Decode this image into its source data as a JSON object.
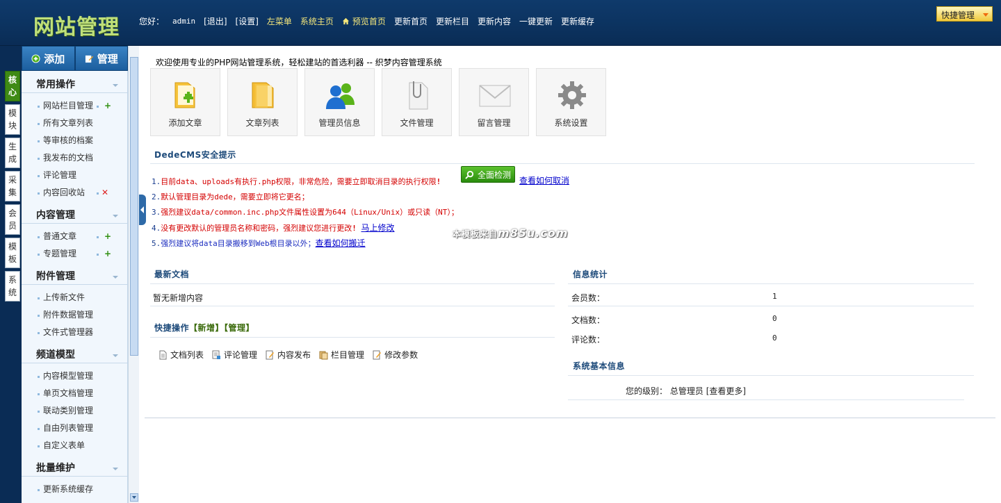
{
  "header": {
    "logo_text": "网站管理",
    "greeting": "您好：",
    "username": "admin",
    "nav": [
      "[退出]",
      "[设置]",
      "左菜单",
      "系统主页",
      "预览首页",
      "更新首页",
      "更新栏目",
      "更新内容",
      "一键更新",
      "更新缓存"
    ],
    "quick_button": "快捷管理"
  },
  "side_tabs": [
    "核心",
    "模块",
    "生成",
    "采集",
    "会员",
    "模板",
    "系统"
  ],
  "menu_head": {
    "add": "添加",
    "manage": "管理"
  },
  "menu": [
    {
      "title": "常用操作",
      "items": [
        {
          "label": "网站栏目管理",
          "mark": "plus"
        },
        {
          "label": "所有文章列表"
        },
        {
          "label": "等审核的档案"
        },
        {
          "label": "我发布的文档"
        },
        {
          "label": "评论管理"
        },
        {
          "label": "内容回收站",
          "mark": "x"
        }
      ]
    },
    {
      "title": "内容管理",
      "items": [
        {
          "label": "普通文章",
          "mark": "plus"
        },
        {
          "label": "专题管理",
          "mark": "plus"
        }
      ]
    },
    {
      "title": "附件管理",
      "items": [
        {
          "label": "上传新文件"
        },
        {
          "label": "附件数据管理"
        },
        {
          "label": "文件式管理器"
        }
      ]
    },
    {
      "title": "频道模型",
      "items": [
        {
          "label": "内容模型管理"
        },
        {
          "label": "单页文档管理"
        },
        {
          "label": "联动类别管理"
        },
        {
          "label": "自由列表管理"
        },
        {
          "label": "自定义表单"
        }
      ]
    },
    {
      "title": "批量维护",
      "items": [
        {
          "label": "更新系统缓存"
        }
      ]
    }
  ],
  "main": {
    "welcome": "欢迎使用专业的PHP网站管理系统，轻松建站的首选利器 -- 织梦内容管理系统",
    "cards": [
      "添加文章",
      "文章列表",
      "管理员信息",
      "文件管理",
      "留言管理",
      "系统设置"
    ],
    "security_title": "DedeCMS安全提示",
    "warnings": {
      "w1": {
        "num": "1.",
        "text": "目前data、uploads有执行.php权限，非常危险，需要立即取消目录的执行权限",
        "bang": "!"
      },
      "w2": {
        "num": "2.",
        "text": "默认管理目录为dede，需要立即将它更名；"
      },
      "w3": {
        "num": "3.",
        "text": "强烈建议data/common.inc.php文件属性设置为644（Linux/Unix）或只读（NT）；"
      },
      "w4": {
        "num": "4.",
        "text": "没有更改默认的管理员名称和密码，强烈建议您进行更改",
        "bang": "!",
        "link": "马上修改"
      },
      "w5": {
        "num": "5.",
        "text": "强烈建议将data目录搬移到Web根目录以外；",
        "link": "查看如何搬迁"
      }
    },
    "check_button": "全面检测",
    "check_link": "查看如何取消",
    "watermark": {
      "prefix": "本模板来自",
      "brand": "m85u.com"
    },
    "latest_title": "最新文档",
    "latest_empty": "暂无新增内容",
    "quick_title": "快捷操作",
    "quick_new": "【新增】",
    "quick_manage": "【管理】",
    "quick_items": [
      "文档列表",
      "评论管理",
      "内容发布",
      "栏目管理",
      "修改参数"
    ],
    "stats_title": "信息统计",
    "stats": [
      {
        "label": "会员数：",
        "value": "1"
      },
      {
        "label": "文档数：",
        "value": "0"
      },
      {
        "label": "评论数：",
        "value": "0"
      }
    ],
    "sysinfo_title": "系统基本信息",
    "level_label": "您的级别：",
    "level_value": "总管理员",
    "more_link": "[查看更多]"
  }
}
